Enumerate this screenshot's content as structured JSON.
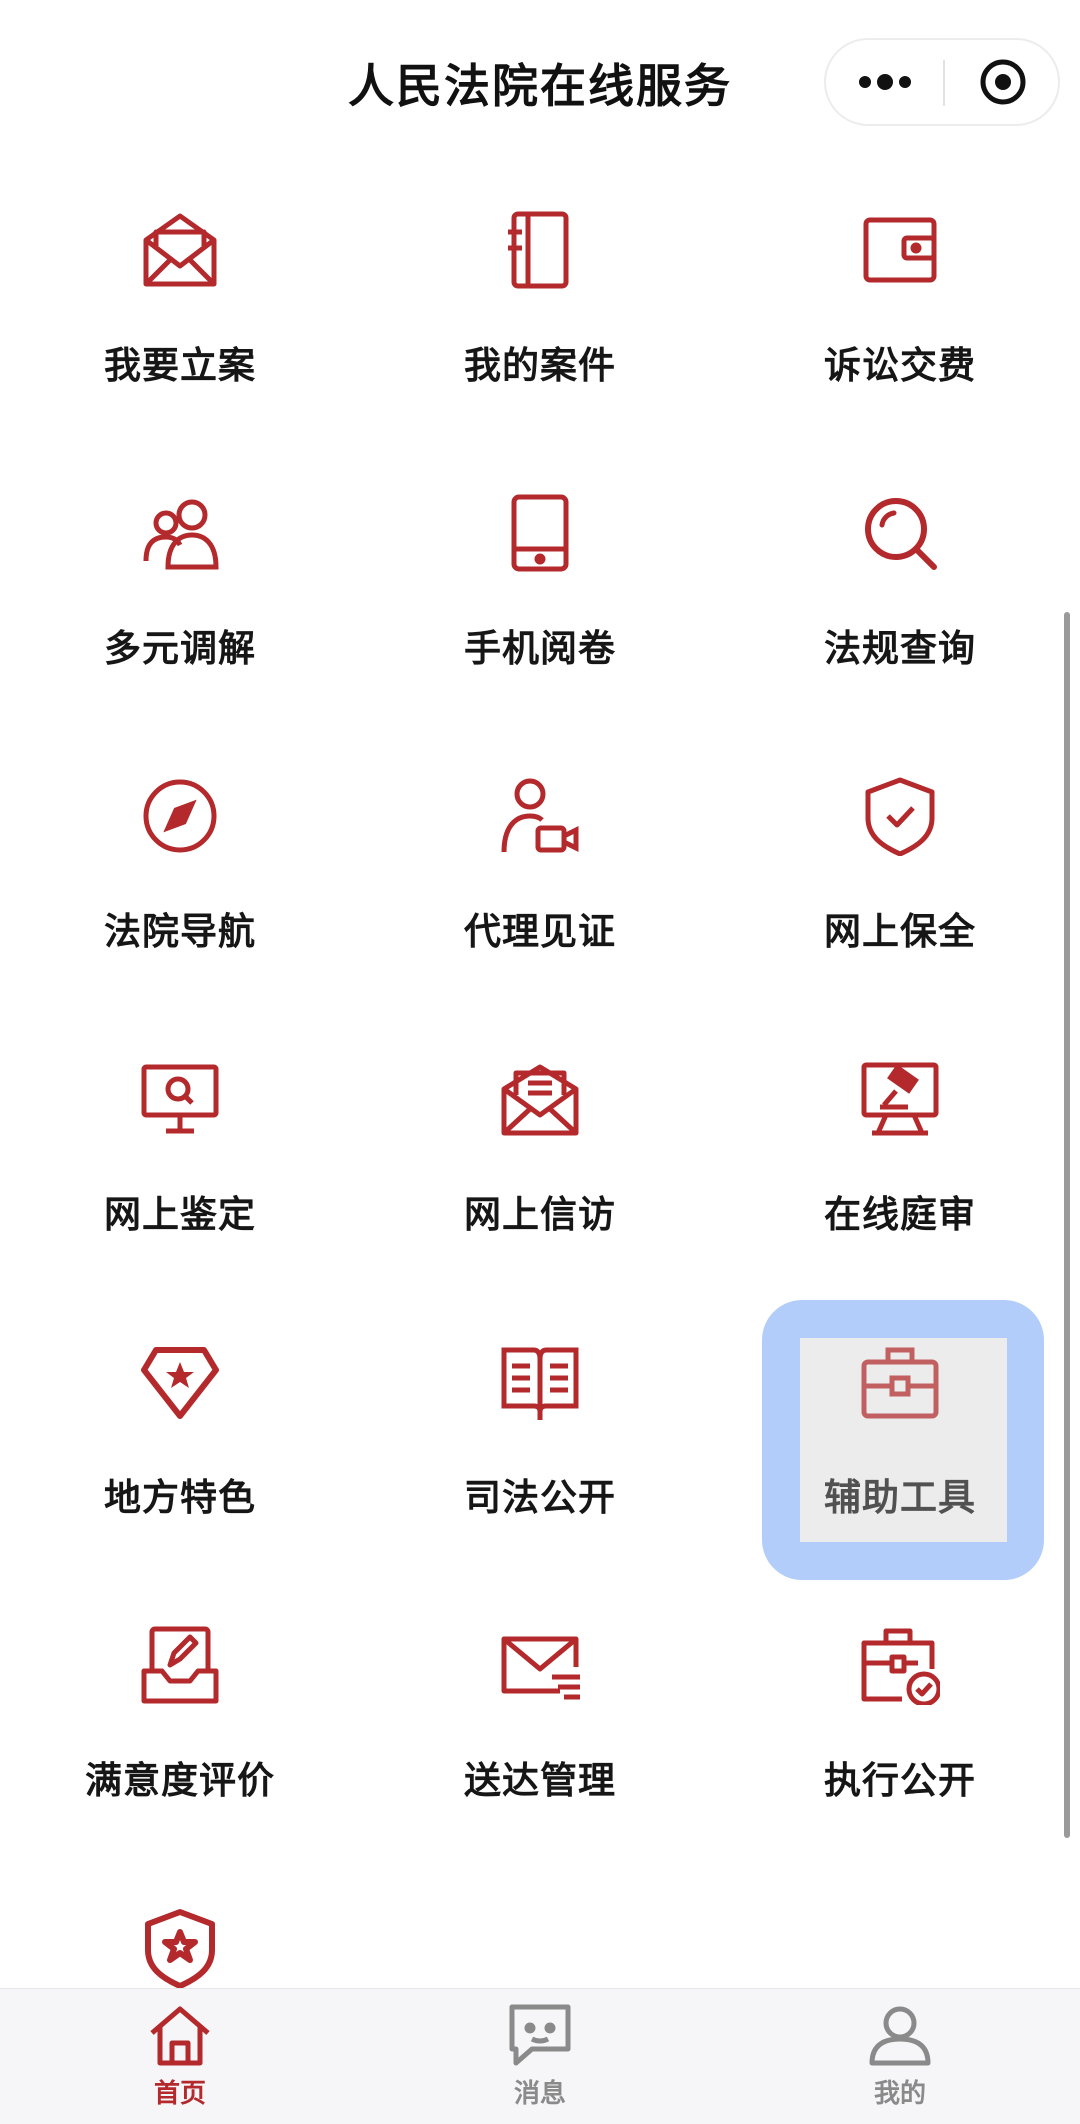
{
  "header": {
    "title": "人民法院在线服务"
  },
  "grid": {
    "items": [
      {
        "label": "我要立案"
      },
      {
        "label": "我的案件"
      },
      {
        "label": "诉讼交费"
      },
      {
        "label": "多元调解"
      },
      {
        "label": "手机阅卷"
      },
      {
        "label": "法规查询"
      },
      {
        "label": "法院导航"
      },
      {
        "label": "代理见证"
      },
      {
        "label": "网上保全"
      },
      {
        "label": "网上鉴定"
      },
      {
        "label": "网上信访"
      },
      {
        "label": "在线庭审"
      },
      {
        "label": "地方特色"
      },
      {
        "label": "司法公开"
      },
      {
        "label": "辅助工具"
      },
      {
        "label": "满意度评价"
      },
      {
        "label": "送达管理"
      },
      {
        "label": "执行公开"
      }
    ]
  },
  "tabbar": {
    "tabs": [
      {
        "label": "首页"
      },
      {
        "label": "消息"
      },
      {
        "label": "我的"
      }
    ]
  },
  "colors": {
    "accent": "#b3292c",
    "highlight": "#b3cdfa",
    "tab_inactive": "#8a8a8a"
  },
  "icons": [
    "envelope-icon",
    "notebook-icon",
    "wallet-icon",
    "people-icon",
    "tablet-icon",
    "search-icon",
    "compass-icon",
    "user-video-icon",
    "shield-check-icon",
    "monitor-search-icon",
    "mail-letter-icon",
    "courtroom-gavel-icon",
    "diamond-star-icon",
    "open-book-icon",
    "toolbox-icon",
    "pen-tray-icon",
    "mail-lines-icon",
    "briefcase-check-icon",
    "shield-star-icon",
    "home-icon",
    "chat-icon",
    "user-icon"
  ]
}
